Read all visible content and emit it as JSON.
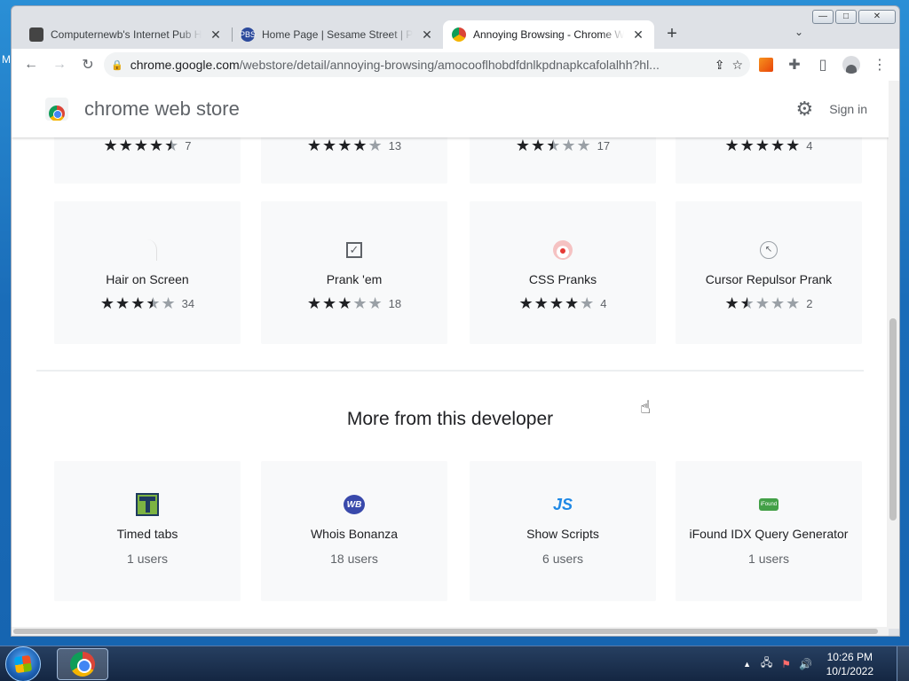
{
  "desktop": {
    "edge_glyph": "M"
  },
  "window": {
    "minimize": "—",
    "maximize": "□",
    "close": "✕"
  },
  "tabs": [
    {
      "title": "Computernewb's Internet Pub Hub",
      "fav": "pub-icon",
      "active": false
    },
    {
      "title": "Home Page | Sesame Street | PBS KIDS",
      "fav": "pbs-icon",
      "fav_text": "PBS",
      "active": false
    },
    {
      "title": "Annoying Browsing - Chrome Web Store",
      "fav": "webstore-icon",
      "active": true
    }
  ],
  "tab_close": "✕",
  "new_tab": "+",
  "tab_search": "⌄",
  "toolbar": {
    "back": "←",
    "forward": "→",
    "reload": "↻",
    "url_host": "chrome.google.com",
    "url_path": "/webstore/detail/annoying-browsing/amocooflhobdfdnlkpdnapkcafolalhh?hl...",
    "share": "⇪",
    "bookmark": "☆",
    "extensions": "✚",
    "sidepanel": "▯",
    "menu": "⋮"
  },
  "store": {
    "title": "chrome web store",
    "sign_in": "Sign in",
    "settings": "⚙"
  },
  "top_row_partial": [
    {
      "stars": 4.5,
      "count": "7"
    },
    {
      "stars": 4,
      "count": "13"
    },
    {
      "stars": 2.5,
      "count": "17"
    },
    {
      "stars": 5,
      "count": "4"
    }
  ],
  "related": [
    {
      "name": "Hair on Screen",
      "stars": 3.5,
      "count": "34",
      "icon": "hair-icon"
    },
    {
      "name": "Prank 'em",
      "stars": 3,
      "count": "18",
      "icon": "checkbox-icon",
      "icon_glyph": "✓"
    },
    {
      "name": "CSS Pranks",
      "stars": 4,
      "count": "4",
      "icon": "clown-icon"
    },
    {
      "name": "Cursor Repulsor Prank",
      "stars": 1.5,
      "count": "2",
      "icon": "cursor-icon",
      "icon_glyph": "↖"
    }
  ],
  "more_title": "More from this developer",
  "more": [
    {
      "name": "Timed tabs",
      "users": "1 users",
      "icon": "timed-tabs-icon"
    },
    {
      "name": "Whois Bonanza",
      "users": "18 users",
      "icon": "wb-icon",
      "icon_glyph": "WB"
    },
    {
      "name": "Show Scripts",
      "users": "6 users",
      "icon": "js-icon",
      "icon_glyph": "JS"
    },
    {
      "name": "iFound IDX Query Generator",
      "users": "1 users",
      "icon": "ifound-icon",
      "icon_glyph": "iFound"
    }
  ],
  "taskbar": {
    "tray_up": "▲",
    "network": "🖧",
    "flag": "⚑",
    "volume": "🔊",
    "time": "10:26 PM",
    "date": "10/1/2022"
  },
  "cursor": "☝"
}
